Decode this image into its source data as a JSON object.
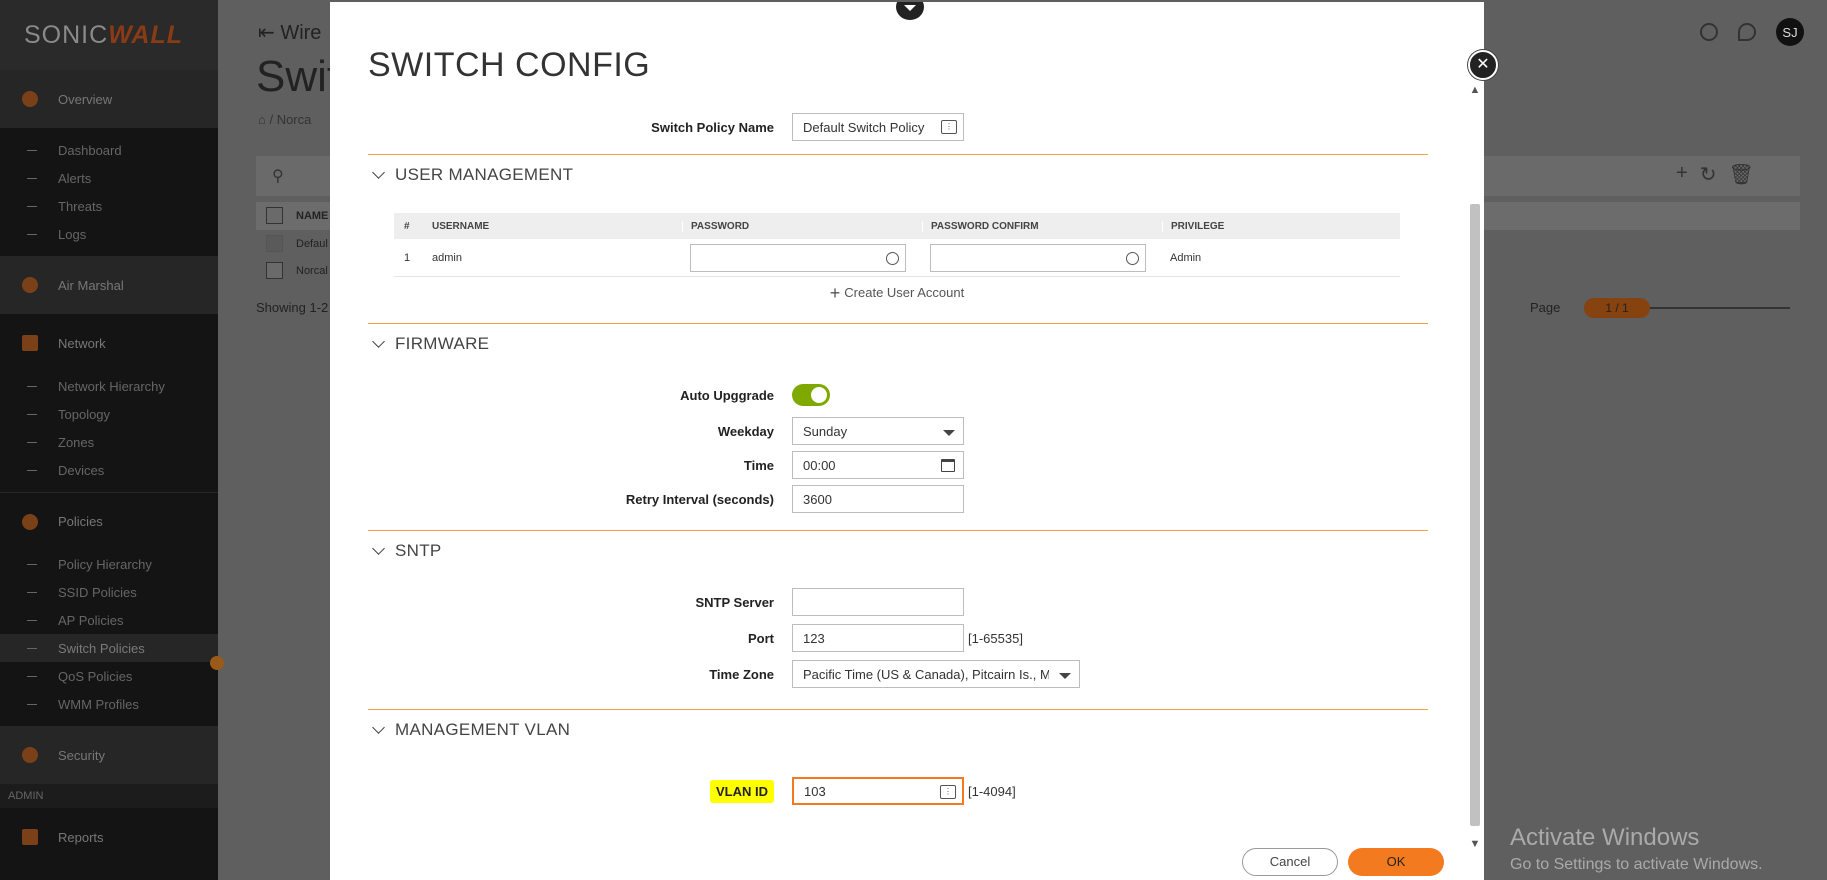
{
  "brand": {
    "logo_pre": "SONIC",
    "logo_post": "WALL"
  },
  "sidebar": {
    "overview": "Overview",
    "overview_items": [
      "Dashboard",
      "Alerts",
      "Threats",
      "Logs"
    ],
    "air_marshal": "Air Marshal",
    "network": "Network",
    "network_items": [
      "Network Hierarchy",
      "Topology",
      "Zones",
      "Devices"
    ],
    "policies": "Policies",
    "policies_items": [
      "Policy Hierarchy",
      "SSID Policies",
      "AP Policies",
      "Switch Policies",
      "QoS Policies",
      "WMM Profiles"
    ],
    "security": "Security",
    "admin_label": "ADMIN",
    "reports": "Reports"
  },
  "background": {
    "title": "Wire",
    "heading": "Swit",
    "breadcrumb": "Norca",
    "col_name": "NAME",
    "row1": "Defaul",
    "row2": "Norcal",
    "showing": "Showing 1-2",
    "page_label": "Page",
    "page_value": "1 / 1",
    "avatar": "SJ"
  },
  "modal": {
    "title": "SWITCH CONFIG",
    "policy_name_label": "Switch Policy Name",
    "policy_name_value": "Default Switch Policy",
    "user_mgmt": {
      "title": "USER MANAGEMENT",
      "headers": [
        "#",
        "USERNAME",
        "PASSWORD",
        "PASSWORD CONFIRM",
        "PRIVILEGE"
      ],
      "rows": [
        {
          "num": "1",
          "username": "admin",
          "privilege": "Admin"
        }
      ],
      "create": "Create User Account"
    },
    "firmware": {
      "title": "FIRMWARE",
      "auto_label": "Auto Upggrade",
      "weekday_label": "Weekday",
      "weekday_value": "Sunday",
      "time_label": "Time",
      "time_value": "00:00",
      "retry_label": "Retry Interval (seconds)",
      "retry_value": "3600"
    },
    "sntp": {
      "title": "SNTP",
      "server_label": "SNTP Server",
      "server_value": "",
      "port_label": "Port",
      "port_value": "123",
      "port_range": "[1-65535]",
      "tz_label": "Time Zone",
      "tz_value": "Pacific Time (US & Canada), Pitcairn Is., Me..."
    },
    "vlan": {
      "title": "MANAGEMENT VLAN",
      "id_label": "VLAN ID",
      "id_value": "103",
      "range": "[1-4094]"
    },
    "cancel": "Cancel",
    "ok": "OK"
  },
  "watermark": {
    "line1": "Activate Windows",
    "line2": "Go to Settings to activate Windows."
  },
  "colors": {
    "accent": "#f47a1f",
    "section_rule": "#f0a046",
    "toggle_on": "#7fa900",
    "highlight": "#ffff00"
  }
}
